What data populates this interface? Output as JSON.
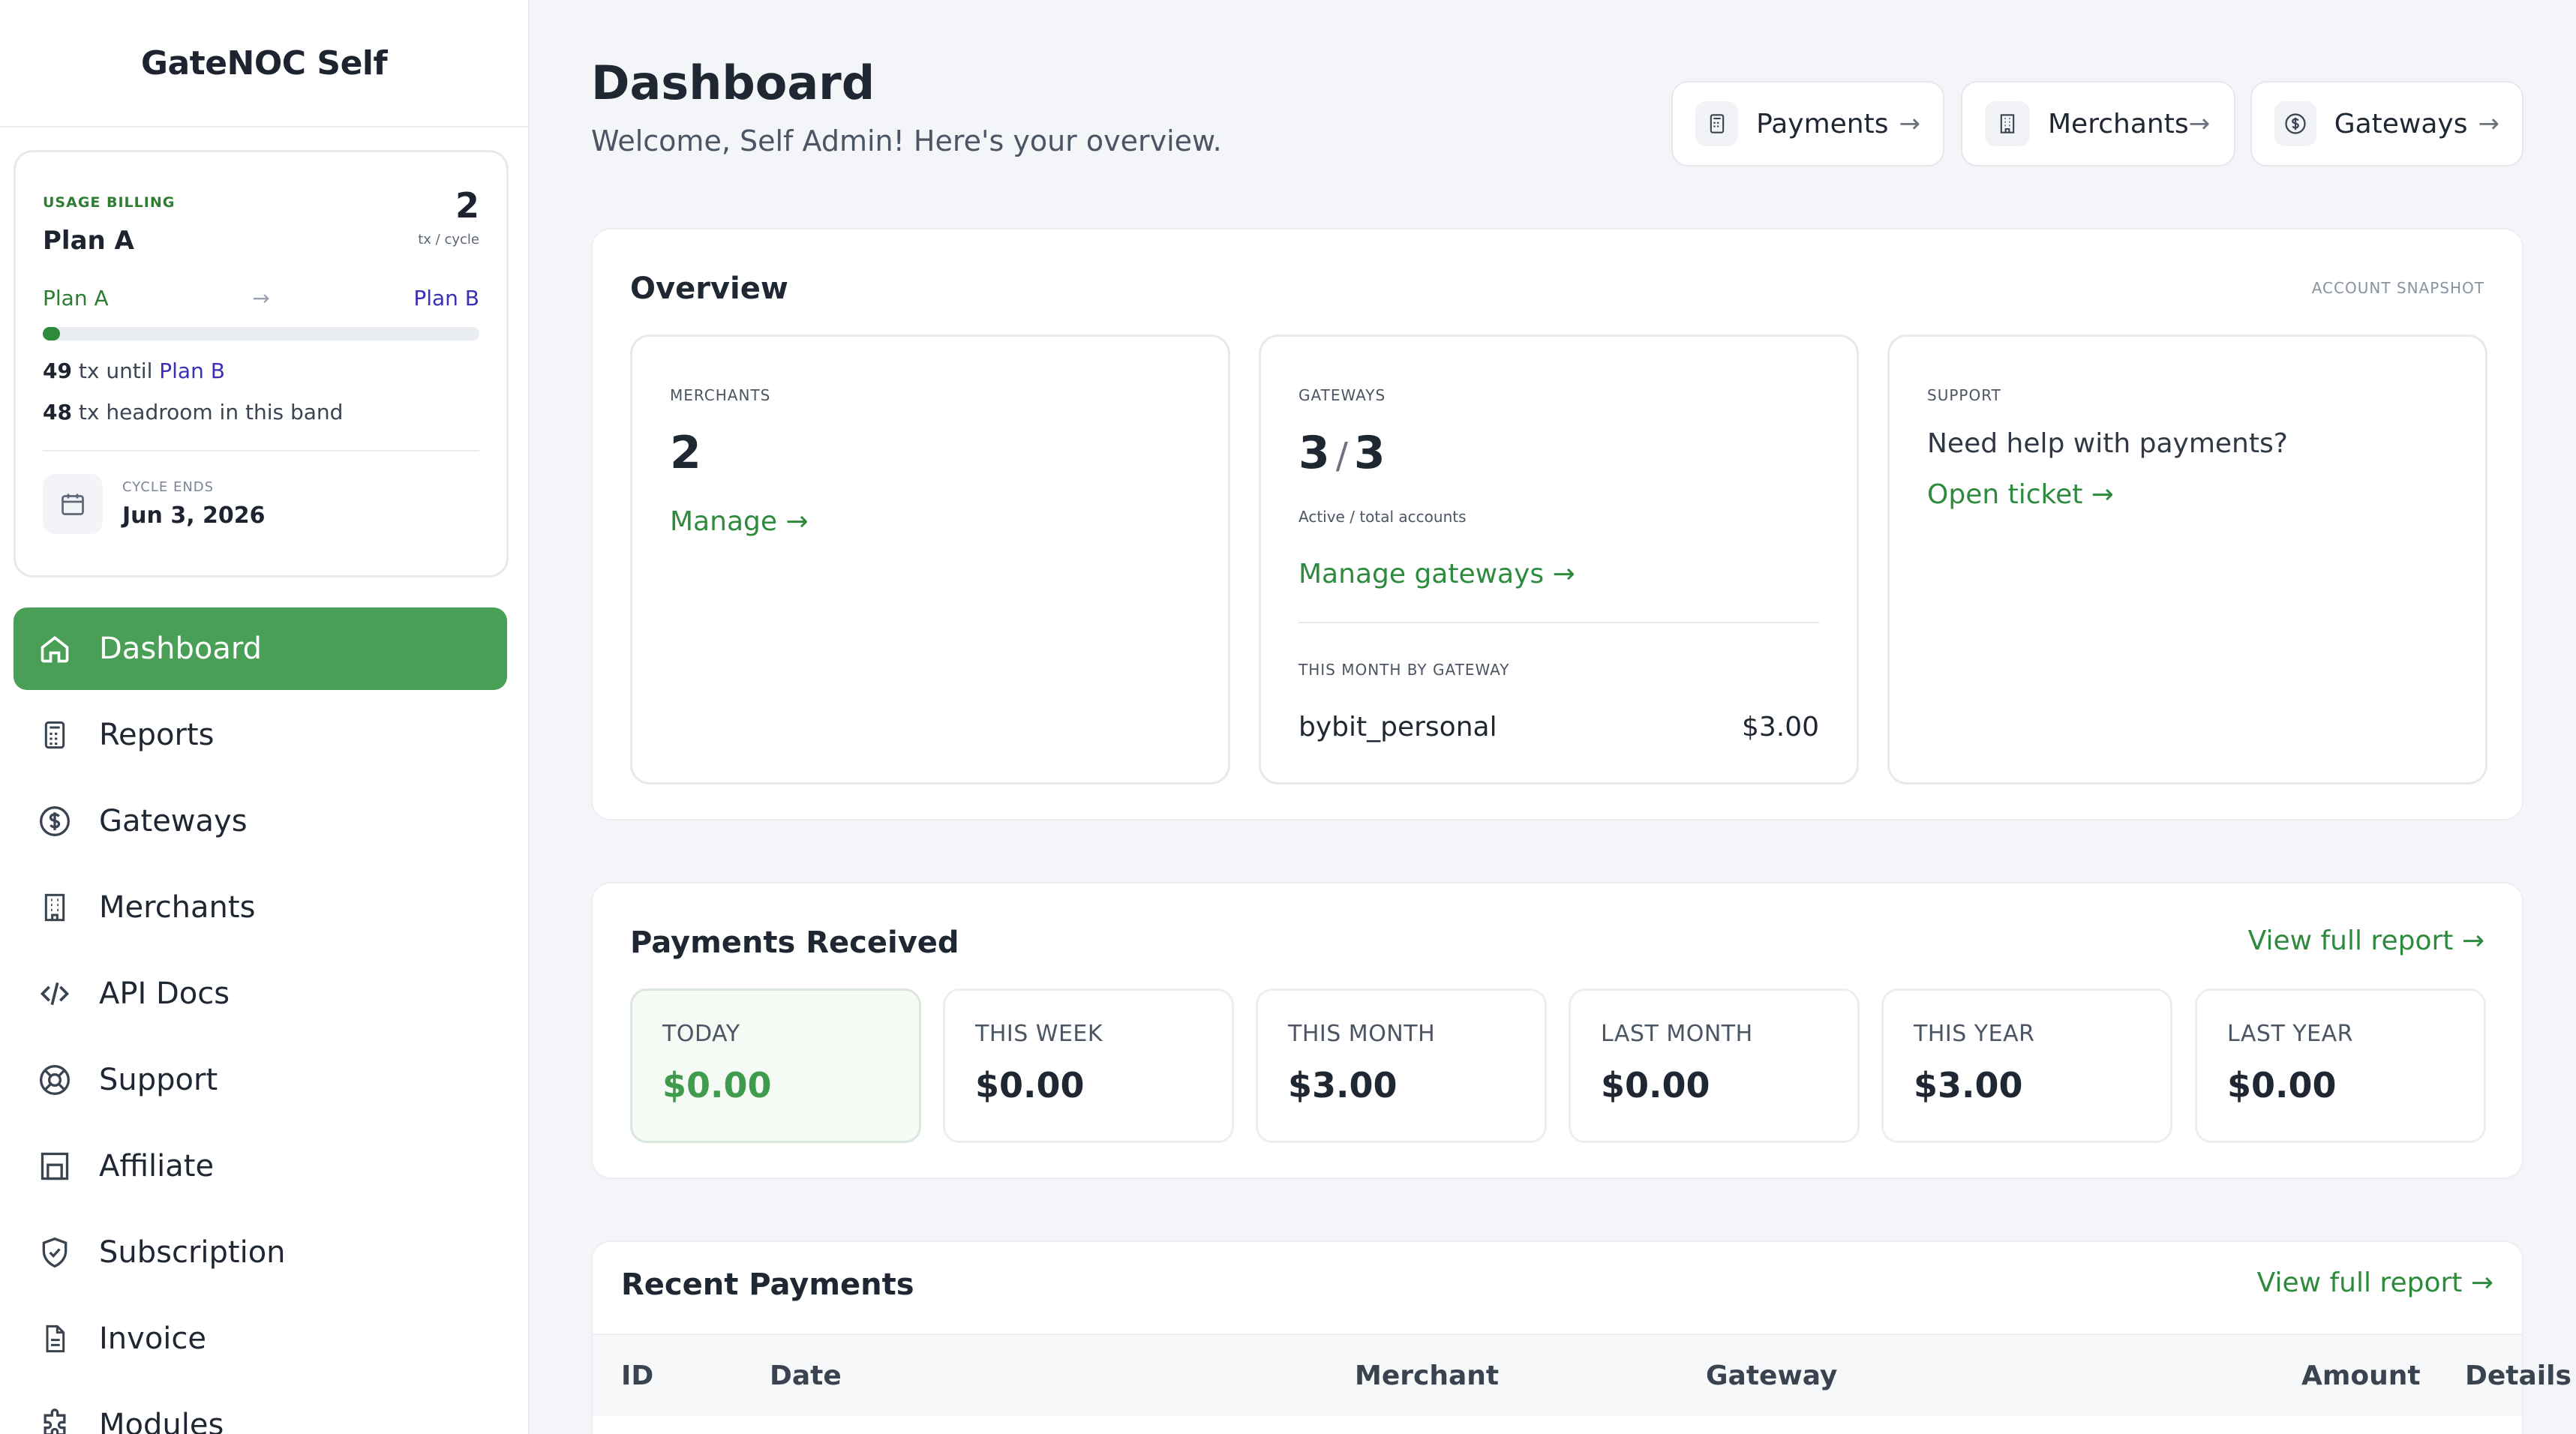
{
  "brand": "GateNOC Self",
  "billing": {
    "usage_label": "USAGE BILLING",
    "plan": "Plan A",
    "count": "2",
    "count_unit": "tx / cycle",
    "from_plan": "Plan A",
    "to_plan": "Plan B",
    "progress_fraction": 0.04,
    "until_count": "49",
    "until_text": " tx until ",
    "until_plan": "Plan B",
    "headroom_count": "48",
    "headroom_text": " tx headroom in this band",
    "cycle_label": "CYCLE ENDS",
    "cycle_date": "Jun 3, 2026"
  },
  "nav": {
    "dashboard": "Dashboard",
    "reports": "Reports",
    "gateways": "Gateways",
    "merchants": "Merchants",
    "api_docs": "API Docs",
    "support": "Support",
    "affiliate": "Affiliate",
    "subscription": "Subscription",
    "invoice": "Invoice",
    "modules": "Modules"
  },
  "header": {
    "title": "Dashboard",
    "welcome": "Welcome, Self Admin! Here's your overview.",
    "quick_payments": "Payments",
    "quick_merchants": "Merchants",
    "quick_gateways": "Gateways"
  },
  "overview": {
    "title": "Overview",
    "snapshot": "ACCOUNT SNAPSHOT",
    "merchants_label": "MERCHANTS",
    "merchants_count": "2",
    "merchants_link": "Manage →",
    "gateways_label": "GATEWAYS",
    "gateways_active": "3",
    "gateways_slash": "/",
    "gateways_total": "3",
    "gateways_sub": "Active / total accounts",
    "gateways_link": "Manage gateways →",
    "month_label": "THIS MONTH BY GATEWAY",
    "month_gateway": "bybit_personal",
    "month_amount": "$3.00",
    "support_label": "SUPPORT",
    "support_question": "Need help with payments?",
    "support_link": "Open ticket →"
  },
  "payments_received": {
    "title": "Payments Received",
    "link": "View full report →",
    "cards": [
      {
        "label": "TODAY",
        "value": "$0.00"
      },
      {
        "label": "THIS WEEK",
        "value": "$0.00"
      },
      {
        "label": "THIS MONTH",
        "value": "$3.00"
      },
      {
        "label": "LAST MONTH",
        "value": "$0.00"
      },
      {
        "label": "THIS YEAR",
        "value": "$3.00"
      },
      {
        "label": "LAST YEAR",
        "value": "$0.00"
      }
    ]
  },
  "recent_payments": {
    "title": "Recent Payments",
    "link": "View full report →",
    "columns": [
      "ID",
      "Date",
      "Merchant",
      "Gateway",
      "Amount",
      "Details"
    ]
  },
  "colors": {
    "accent": "#4a9f56",
    "link": "#2e8b3e",
    "plan_b": "#3b2fb8"
  }
}
